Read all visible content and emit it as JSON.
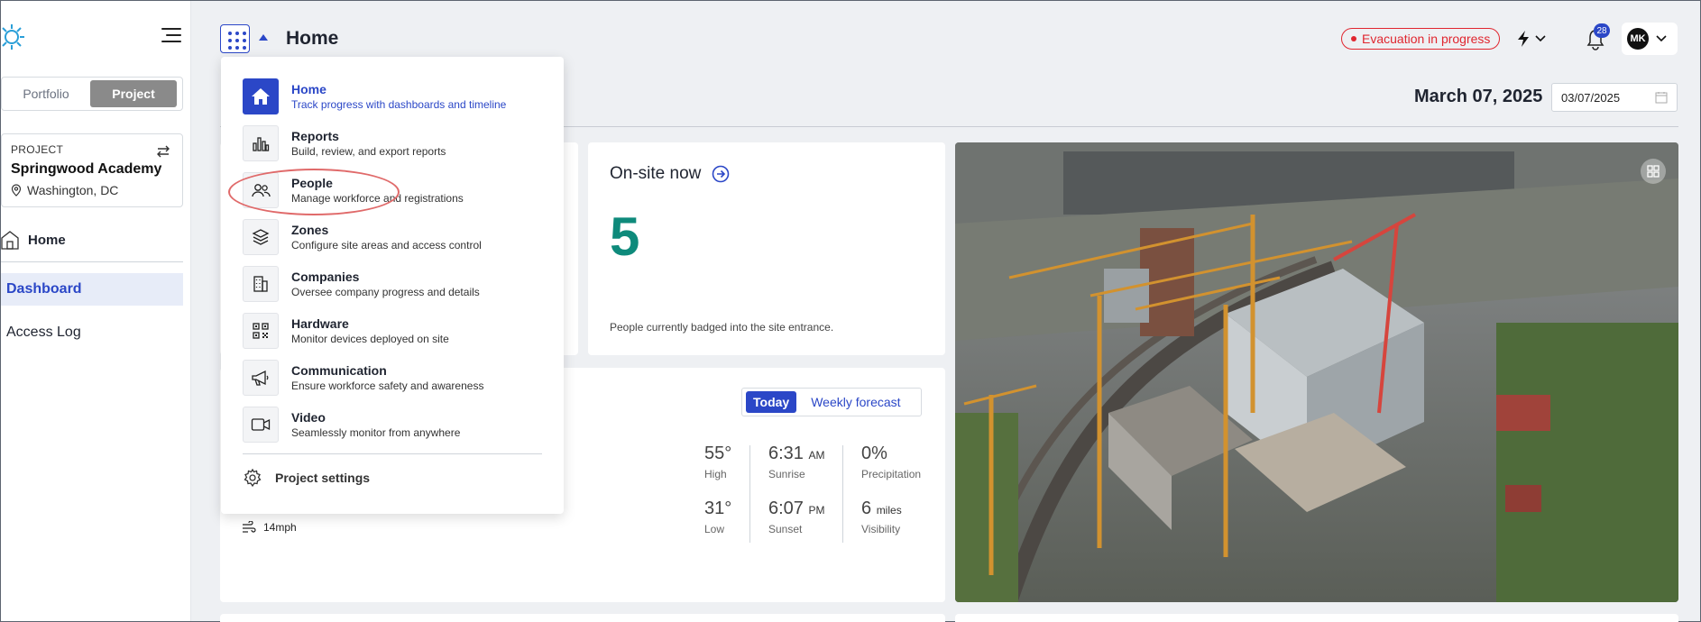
{
  "sidebar": {
    "portfolio_label": "Portfolio",
    "project_label": "Project",
    "project_card": {
      "label": "PROJECT",
      "name": "Springwood Academy",
      "location": "Washington, DC"
    },
    "nav": {
      "home": "Home",
      "dashboard": "Dashboard",
      "access_log": "Access Log"
    }
  },
  "header": {
    "title": "Home",
    "evacuation_label": "Evacuation in progress",
    "notification_count": "28",
    "user_initials": "MK"
  },
  "date": {
    "display": "March 07, 2025",
    "input_value": "03/07/2025"
  },
  "onsite": {
    "title": "On-site now",
    "count": "5",
    "caption": "People currently badged into the site entrance."
  },
  "weather": {
    "toggle_today": "Today",
    "toggle_weekly": "Weekly forecast",
    "high_value": "55°",
    "high_label": "High",
    "low_value": "31°",
    "low_label": "Low",
    "sunrise_value": "6:31",
    "sunrise_suffix": "AM",
    "sunrise_label": "Sunrise",
    "sunset_value": "6:07",
    "sunset_suffix": "PM",
    "sunset_label": "Sunset",
    "precip_value": "0%",
    "precip_label": "Precipitation",
    "visibility_value": "6",
    "visibility_suffix": "miles",
    "visibility_label": "Visibility",
    "wind": "14mph"
  },
  "menu": {
    "items": [
      {
        "title": "Home",
        "subtitle": "Track progress with dashboards and timeline",
        "icon": "home-icon"
      },
      {
        "title": "Reports",
        "subtitle": "Build, review, and export reports",
        "icon": "bar-chart-icon"
      },
      {
        "title": "People",
        "subtitle": "Manage workforce and registrations",
        "icon": "people-icon"
      },
      {
        "title": "Zones",
        "subtitle": "Configure site areas and access control",
        "icon": "layers-icon"
      },
      {
        "title": "Companies",
        "subtitle": "Oversee company progress and details",
        "icon": "building-icon"
      },
      {
        "title": "Hardware",
        "subtitle": "Monitor devices deployed on site",
        "icon": "qr-code-icon"
      },
      {
        "title": "Communication",
        "subtitle": "Ensure workforce safety and awareness",
        "icon": "megaphone-icon"
      },
      {
        "title": "Video",
        "subtitle": "Seamlessly monitor from anywhere",
        "icon": "video-camera-icon"
      }
    ],
    "settings": "Project settings"
  },
  "colors": {
    "accent": "#2b47c7",
    "alert": "#e0262f",
    "onsite": "#0e8a7b"
  }
}
